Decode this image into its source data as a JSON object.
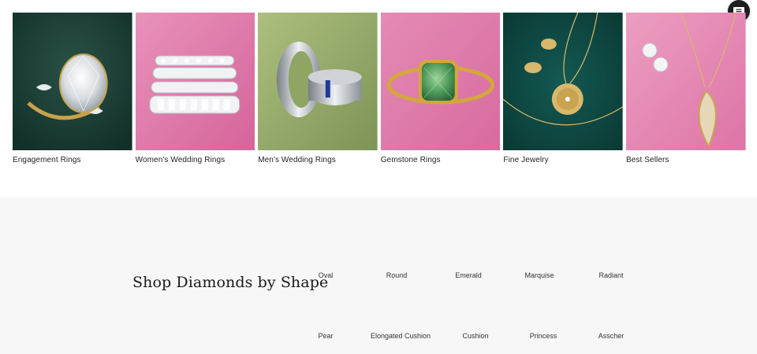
{
  "chat": {
    "icon": "chat-bubble-icon"
  },
  "categories": [
    {
      "label": "Engagement Rings",
      "bg": "#1d3b33"
    },
    {
      "label": "Women's Wedding Rings",
      "bg": "#e07aa8"
    },
    {
      "label": "Men's Wedding Rings",
      "bg": "#9aae6c"
    },
    {
      "label": "Gemstone Rings",
      "bg": "#de7faa"
    },
    {
      "label": "Fine Jewelry",
      "bg": "#0f4a45"
    },
    {
      "label": "Best Sellers",
      "bg": "#e587b2"
    }
  ],
  "shape_section": {
    "title": "Shop Diamonds by Shape",
    "shapes_row1": [
      "Oval",
      "Round",
      "Emerald",
      "Marquise",
      "Radiant"
    ],
    "shapes_row2": [
      "Pear",
      "Elongated Cushion",
      "Cushion",
      "Princess",
      "Asscher"
    ]
  },
  "colors": {
    "section_bg": "#f7f7f7",
    "chat_btn": "#1e1e1e"
  }
}
